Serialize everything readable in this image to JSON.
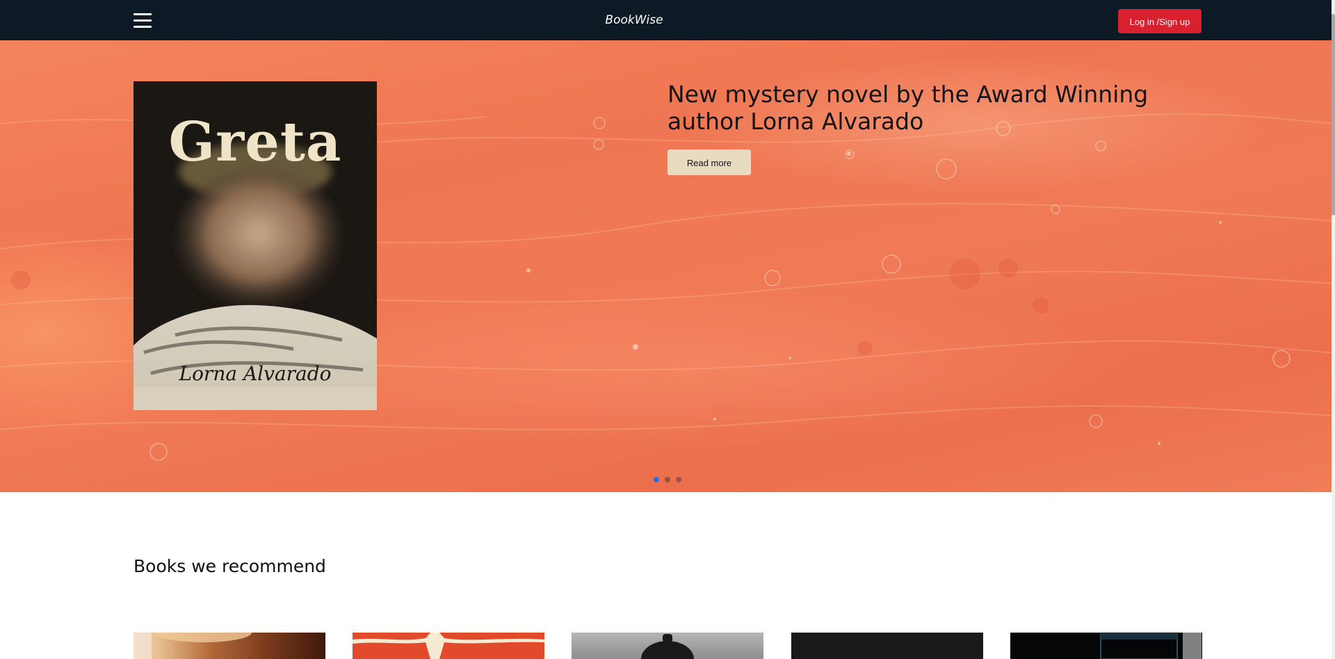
{
  "header": {
    "menu_icon": "hamburger-menu-icon",
    "brand": "BookWise",
    "login_label": "Log in /Sign up"
  },
  "hero": {
    "cover_title": "Greta",
    "cover_author": "Lorna Alvarado",
    "heading": "New mystery novel by the Award Winning author Lorna Alvarado",
    "read_more_label": "Read more",
    "slides_total": 3,
    "active_slide": 1
  },
  "recommend": {
    "title": "Books we recommend",
    "next_icon": "chevron-right-icon"
  },
  "colors": {
    "navbar": "#0d1a26",
    "accent_red": "#d9202f",
    "hero_orange": "#ef7652",
    "read_more_bg": "#e8dcc0",
    "dot_active": "#2a6fe0"
  }
}
